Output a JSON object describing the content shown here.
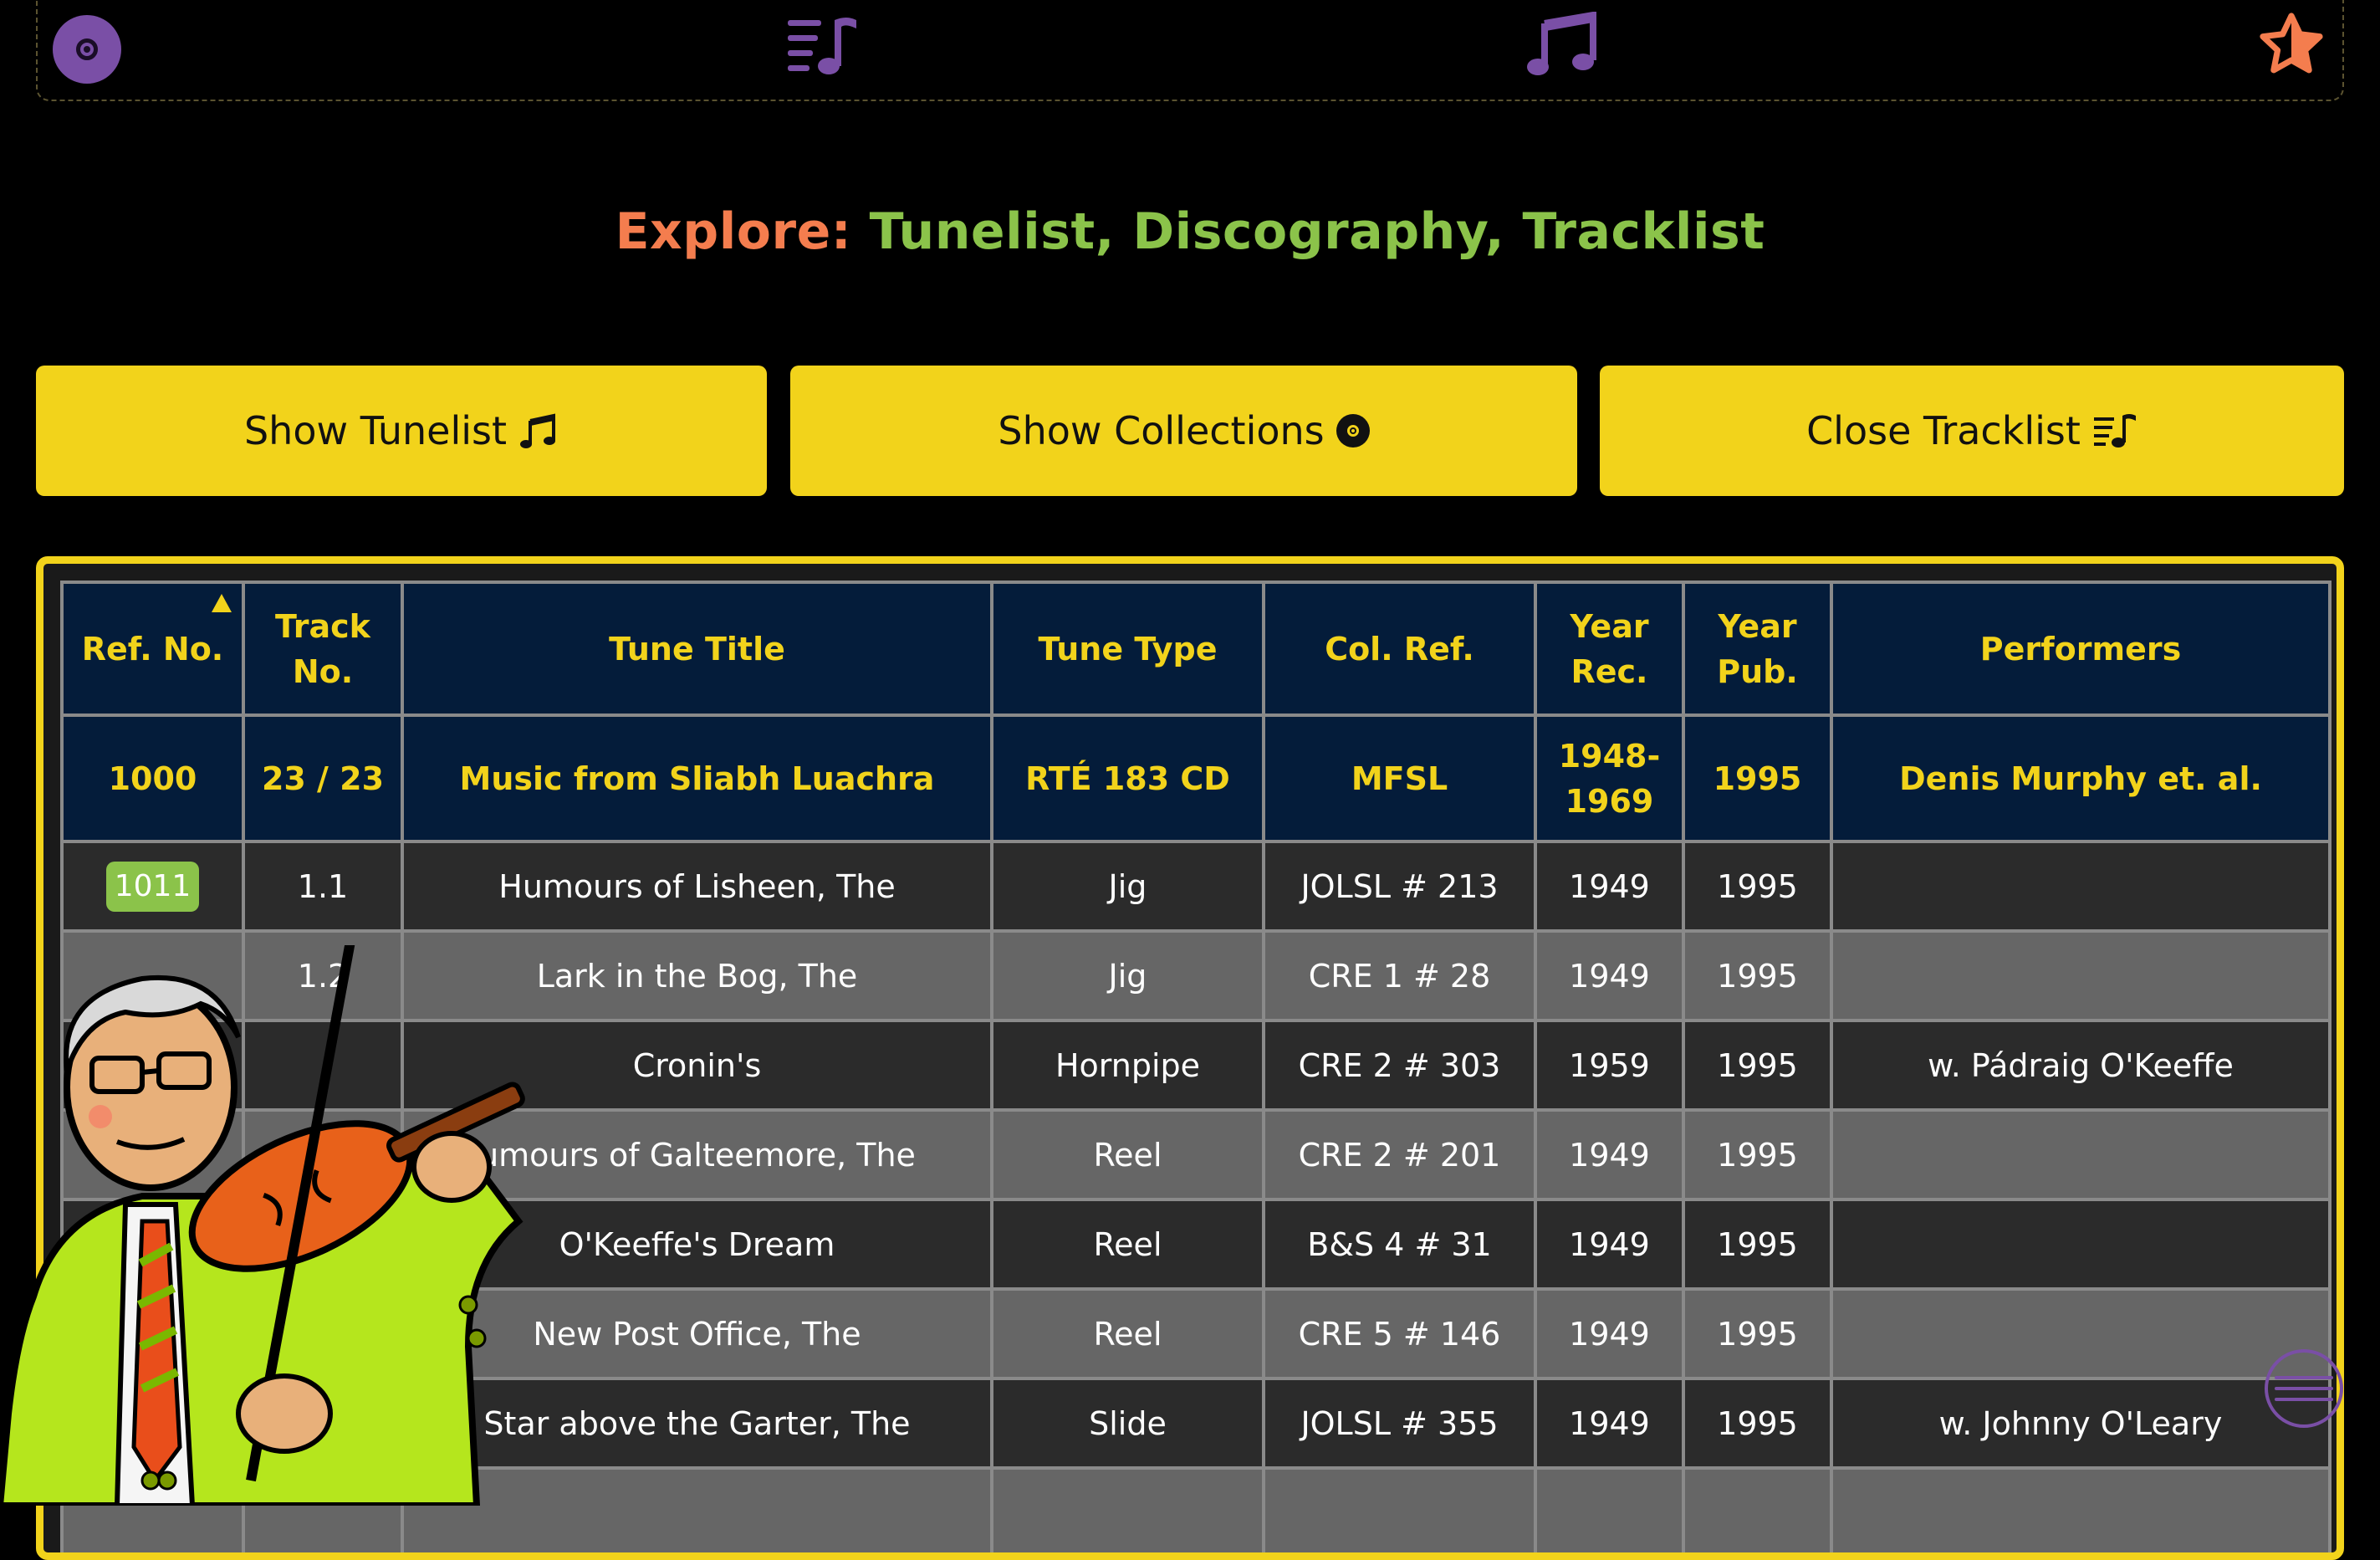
{
  "nav": {
    "icons": [
      "disc-icon",
      "tracklist-icon",
      "music-notes-icon",
      "star-icon"
    ],
    "colors": {
      "purple": "#7a4fa6",
      "star": "#f47d4e"
    }
  },
  "heading": {
    "label": "Explore:",
    "value": "Tunelist, Discography, Tracklist"
  },
  "buttons": {
    "tunelist": "Show Tunelist",
    "collections": "Show Collections",
    "tracklist": "Close Tracklist"
  },
  "table": {
    "headers": {
      "ref": "Ref. No.",
      "track_a": "Track",
      "track_b": "No.",
      "title": "Tune Title",
      "type": "Tune Type",
      "col": "Col. Ref.",
      "year_rec_a": "Year",
      "year_rec_b": "Rec.",
      "year_pub_a": "Year",
      "year_pub_b": "Pub.",
      "performers": "Performers"
    },
    "album": {
      "ref": "1000",
      "track": "23 / 23",
      "title": "Music from Sliabh Luachra",
      "type": "RTÉ 183 CD",
      "col": "MFSL",
      "year_rec_a": "1948-",
      "year_rec_b": "1969",
      "year_pub": "1995",
      "performers": "Denis Murphy et. al."
    },
    "rows": [
      {
        "ref": "1011",
        "track": "1.1",
        "title": "Humours of Lisheen, The",
        "type": "Jig",
        "col": "JOLSL # 213",
        "year_rec": "1949",
        "year_pub": "1995",
        "performers": ""
      },
      {
        "ref": "",
        "track": "1.2",
        "title": "Lark in the Bog, The",
        "type": "Jig",
        "col": "CRE 1 # 28",
        "year_rec": "1949",
        "year_pub": "1995",
        "performers": ""
      },
      {
        "ref": "",
        "track": "",
        "title": "Cronin's",
        "type": "Hornpipe",
        "col": "CRE 2 # 303",
        "year_rec": "1959",
        "year_pub": "1995",
        "performers": "w. Pádraig O'Keeffe"
      },
      {
        "ref": "",
        "track": "",
        "title": "umours of Galteemore, The",
        "type": "Reel",
        "col": "CRE 2 # 201",
        "year_rec": "1949",
        "year_pub": "1995",
        "performers": ""
      },
      {
        "ref": "",
        "track": "",
        "title": "O'Keeffe's Dream",
        "type": "Reel",
        "col": "B&S 4 # 31",
        "year_rec": "1949",
        "year_pub": "1995",
        "performers": ""
      },
      {
        "ref": "",
        "track": "",
        "title": "New Post Office, The",
        "type": "Reel",
        "col": "CRE 5 # 146",
        "year_rec": "1949",
        "year_pub": "1995",
        "performers": ""
      },
      {
        "ref": "",
        "track": "",
        "title": "Star above the Garter, The",
        "type": "Slide",
        "col": "JOLSL # 355",
        "year_rec": "1949",
        "year_pub": "1995",
        "performers": "w. Johnny O'Leary"
      }
    ]
  }
}
